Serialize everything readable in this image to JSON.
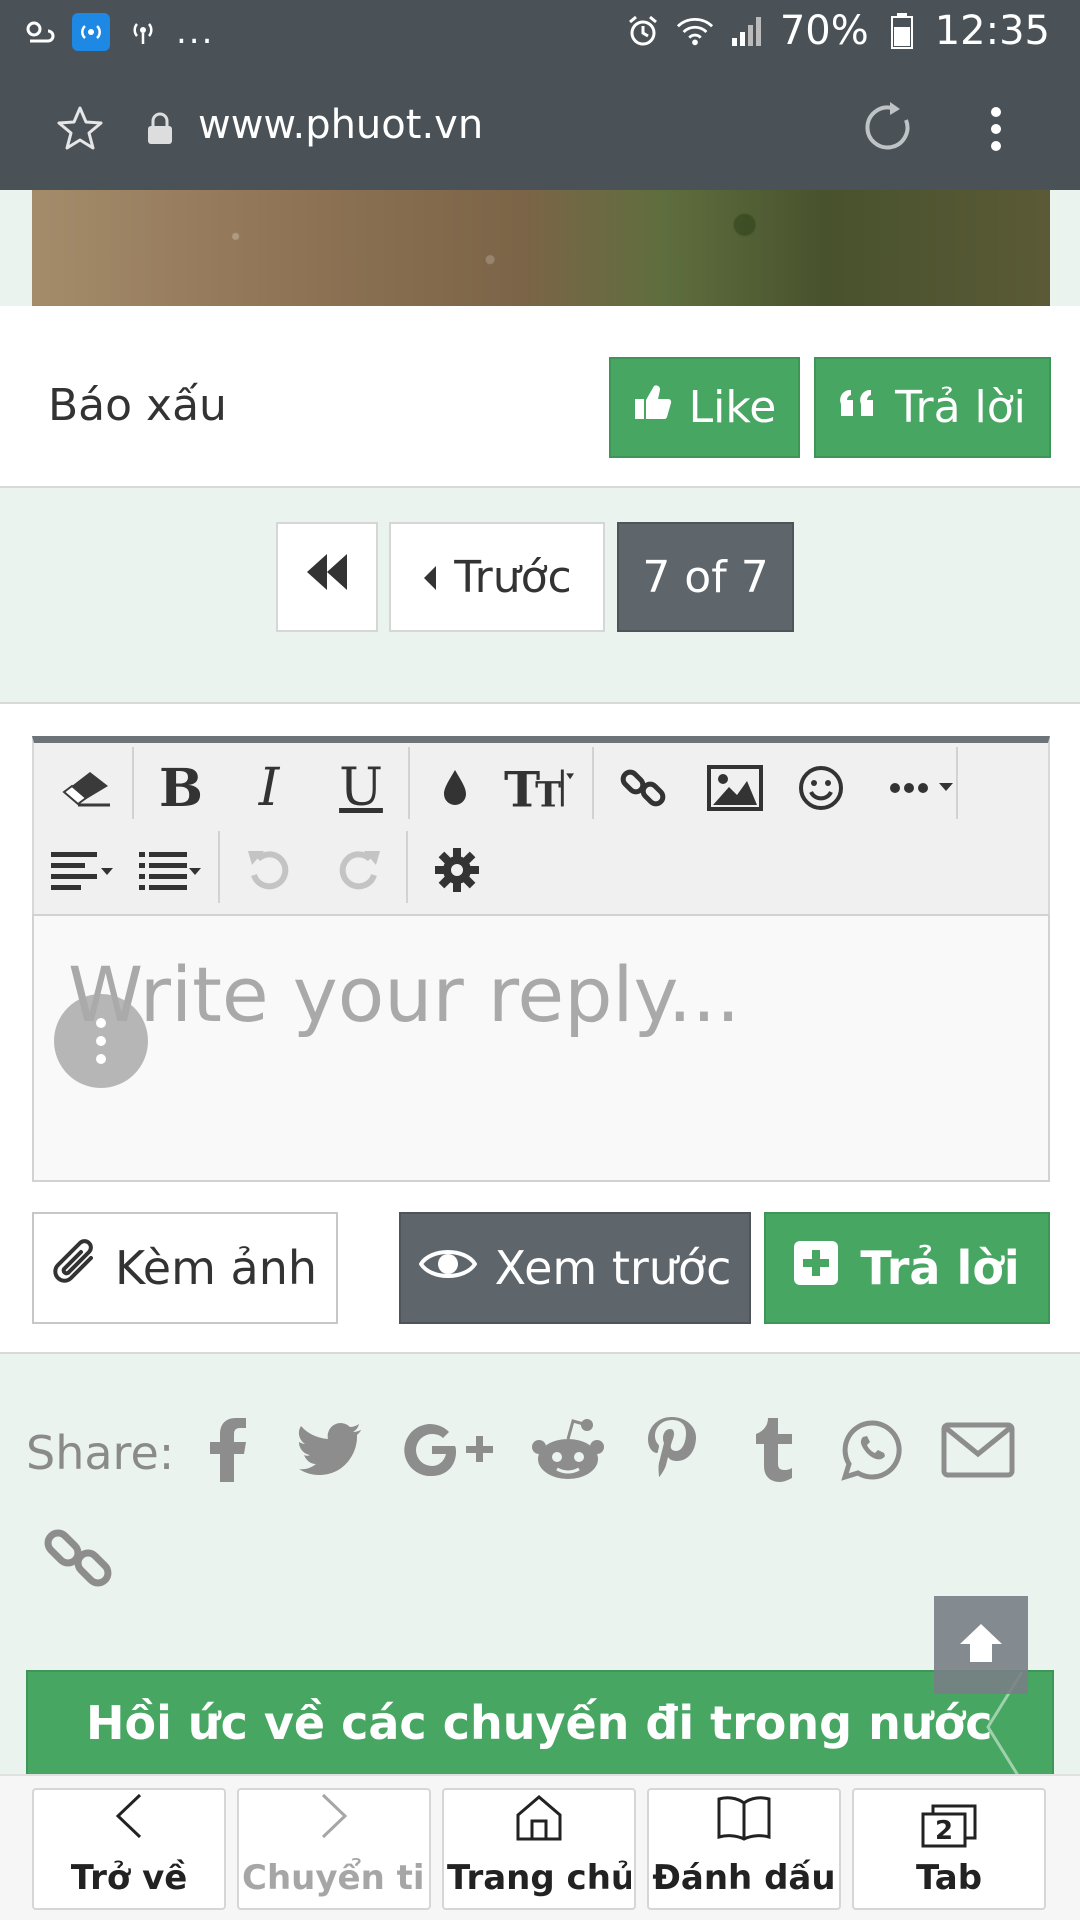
{
  "status_bar": {
    "battery": "70%",
    "time": "12:35",
    "overflow": "..."
  },
  "browser": {
    "url": "www.phuot.vn"
  },
  "post": {
    "report_label": "Báo xấu",
    "like_label": "Like",
    "reply_label": "Trả lời"
  },
  "pagination": {
    "prev_label": "Trước",
    "current": "7 of 7"
  },
  "editor": {
    "placeholder": "Write your reply...",
    "attach_label": "Kèm ảnh",
    "preview_label": "Xem trước",
    "submit_label": "Trả lời"
  },
  "share": {
    "label": "Share:",
    "icons": [
      "facebook-icon",
      "twitter-icon",
      "google-plus-icon",
      "reddit-icon",
      "pinterest-icon",
      "tumblr-icon",
      "whatsapp-icon",
      "email-icon",
      "link-icon"
    ]
  },
  "banner": {
    "title": "Hồi ức về các chuyến đi trong nước"
  },
  "bottom_nav": {
    "items": [
      {
        "label": "Trở về",
        "icon": "chevron-left-icon"
      },
      {
        "label": "Chuyển ti...",
        "icon": "chevron-right-icon"
      },
      {
        "label": "Trang chủ",
        "icon": "home-icon"
      },
      {
        "label": "Đánh dấu",
        "icon": "book-icon"
      },
      {
        "label": "Tab",
        "icon": "tabs-icon",
        "count": "2"
      }
    ]
  },
  "colors": {
    "accent_green": "#48a663",
    "dark_gray": "#5e666b",
    "page_bg": "#eaf3ee",
    "chrome": "#4a5257"
  }
}
